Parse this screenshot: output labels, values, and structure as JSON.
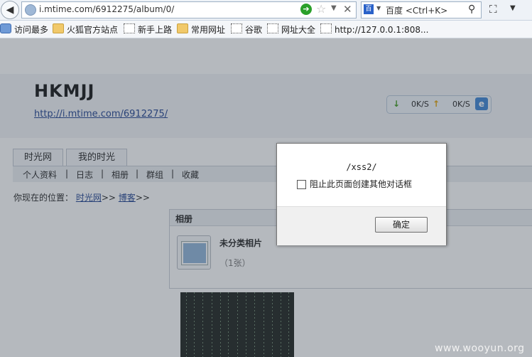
{
  "browser": {
    "url": "i.mtime.com/6912275/album/0/",
    "search_engine_label": "百度 <Ctrl+K>",
    "bookmarks": [
      {
        "label": "访问最多",
        "icon": "search-bookmark-icon"
      },
      {
        "label": "火狐官方站点",
        "icon": "folder-icon"
      },
      {
        "label": "新手上路",
        "icon": "page-icon"
      },
      {
        "label": "常用网址",
        "icon": "folder-icon"
      },
      {
        "label": "谷歌",
        "icon": "page-icon"
      },
      {
        "label": "网址大全",
        "icon": "page-icon"
      },
      {
        "label": "http://127.0.0.1:808...",
        "icon": "page-icon"
      }
    ]
  },
  "page": {
    "site_title": "HKMJJ",
    "site_url": "http://i.mtime.com/6912275/",
    "speed": {
      "down": "0K/S",
      "up": "0K/S"
    },
    "tabs": [
      "时光网",
      "我的时光"
    ],
    "subnav": [
      "个人资料",
      "|",
      "日志",
      "|",
      "相册",
      "|",
      "群组",
      "|",
      "收藏"
    ],
    "location": {
      "prefix": "你现在的位置：",
      "link1": "时光网",
      "sep1": ">>",
      "link2": "博客",
      "sep2": ">>"
    },
    "album": {
      "section_title": "相册",
      "name": "未分类相片",
      "count": "（1张）"
    }
  },
  "dialog": {
    "message": "/xss2/",
    "checkbox_label": "阻止此页面创建其他对话框",
    "ok_label": "确定"
  },
  "watermark": "www.wooyun.org"
}
